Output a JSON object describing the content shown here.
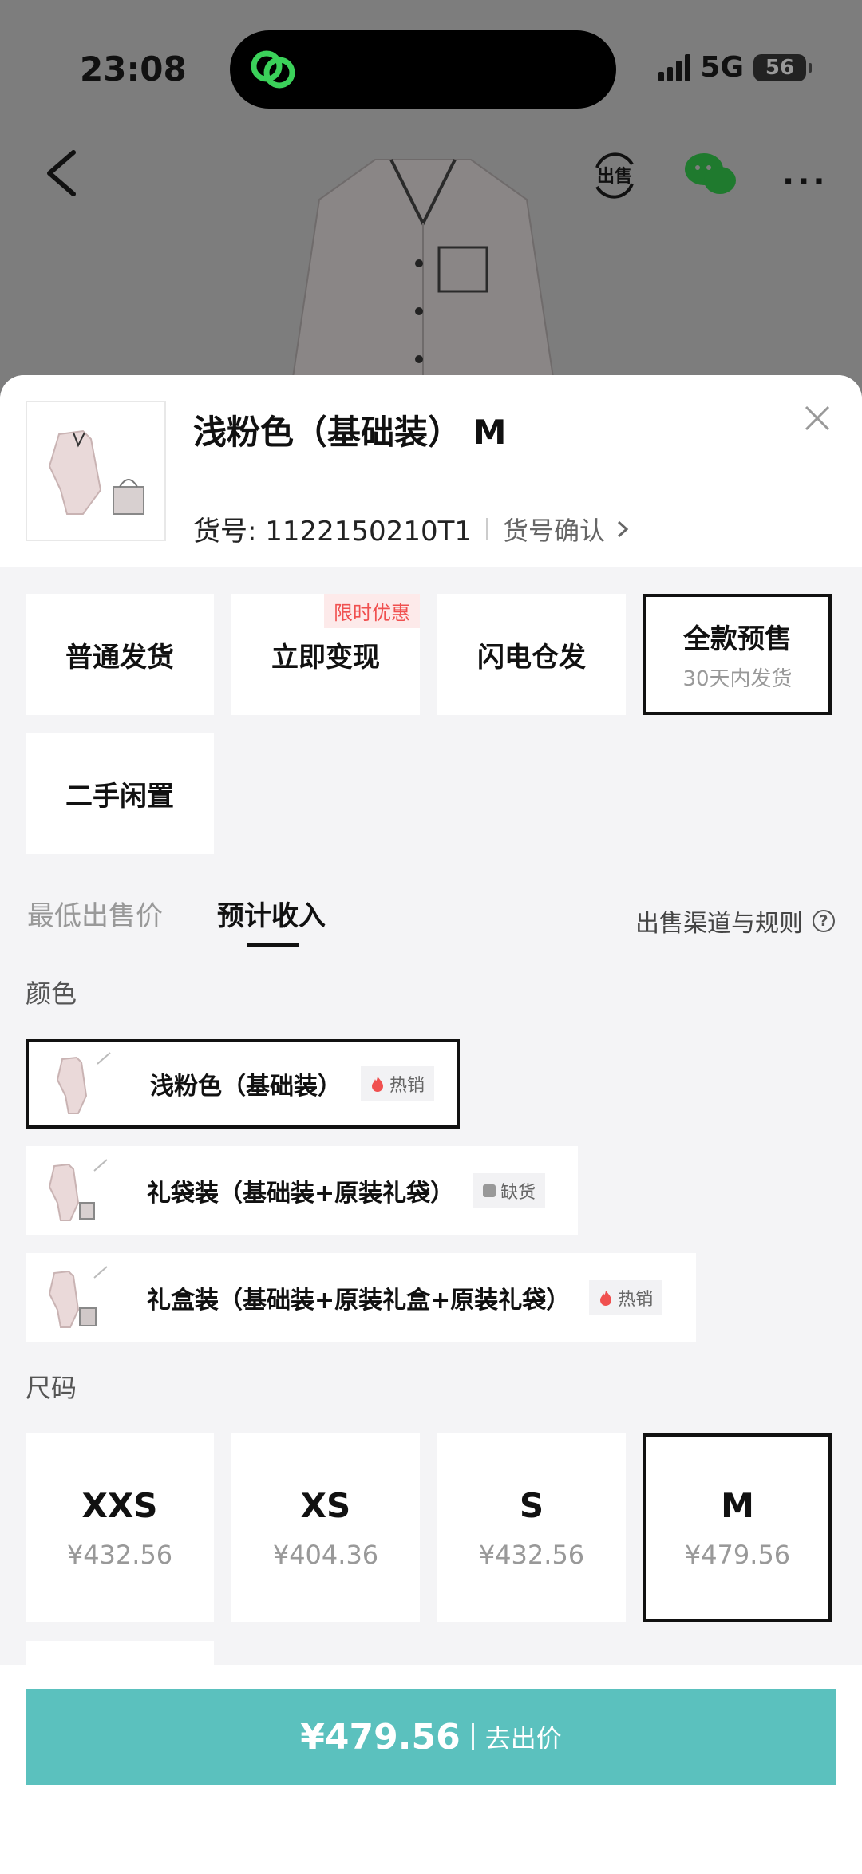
{
  "status_bar": {
    "time": "23:08",
    "network": "5G",
    "battery": "56"
  },
  "nav": {
    "sell_label": "出售"
  },
  "sheet": {
    "title": "浅粉色（基础装） M",
    "sku_label": "货号: 1122150210T1",
    "sku_confirm": "货号确认"
  },
  "shipping": [
    {
      "label": "普通发货",
      "sub": "",
      "tag": "",
      "selected": false
    },
    {
      "label": "立即变现",
      "sub": "",
      "tag": "限时优惠",
      "selected": false
    },
    {
      "label": "闪电仓发",
      "sub": "",
      "tag": "",
      "selected": false
    },
    {
      "label": "全款预售",
      "sub": "30天内发货",
      "tag": "",
      "selected": true
    },
    {
      "label": "二手闲置",
      "sub": "",
      "tag": "",
      "selected": false
    }
  ],
  "tabs": {
    "lowest": "最低出售价",
    "estimated": "预计收入",
    "active": "estimated"
  },
  "rules_link": "出售渠道与规则",
  "color_section": {
    "label": "颜色",
    "options": [
      {
        "name": "浅粉色（基础装）",
        "badge": "热销",
        "badge_icon": "flame-icon",
        "selected": true
      },
      {
        "name": "礼袋装（基础装+原装礼袋）",
        "badge": "缺货",
        "badge_icon": "lock-icon",
        "selected": false
      },
      {
        "name": "礼盒装（基础装+原装礼盒+原装礼袋）",
        "badge": "热销",
        "badge_icon": "flame-icon",
        "selected": false
      }
    ]
  },
  "size_section": {
    "label": "尺码",
    "options": [
      {
        "size": "XXS",
        "price": "¥432.56",
        "selected": false
      },
      {
        "size": "XS",
        "price": "¥404.36",
        "selected": false
      },
      {
        "size": "S",
        "price": "¥432.56",
        "selected": false
      },
      {
        "size": "M",
        "price": "¥479.56",
        "selected": true
      }
    ]
  },
  "cta": {
    "price": "¥479.56",
    "label": "去出价"
  },
  "colors": {
    "accent": "#5bc1be",
    "promo": "#f0504f",
    "hot": "#f0504f"
  }
}
